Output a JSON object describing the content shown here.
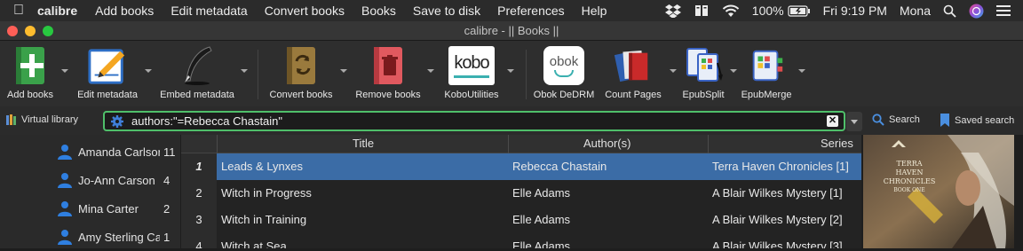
{
  "menubar": {
    "app_name": "calibre",
    "items": [
      "Add books",
      "Edit metadata",
      "Convert books",
      "Books",
      "Save to disk",
      "Preferences",
      "Help"
    ],
    "battery": "100%",
    "clock": "Fri 9:19 PM",
    "user": "Mona"
  },
  "window": {
    "title": "calibre - || Books ||"
  },
  "toolbar": {
    "tools": [
      {
        "label": "Add books"
      },
      {
        "label": "Edit metadata"
      },
      {
        "label": "Embed metadata"
      },
      {
        "label": "Convert books"
      },
      {
        "label": "Remove books"
      },
      {
        "label": "KoboUtilities"
      },
      {
        "label": "Obok DeDRM"
      },
      {
        "label": "Count Pages"
      },
      {
        "label": "EpubSplit"
      },
      {
        "label": "EpubMerge"
      }
    ],
    "kobo_text": "kobo",
    "obok_text": "obok"
  },
  "search": {
    "virtual_library": "Virtual library",
    "query": "authors:\"=Rebecca Chastain\"",
    "search_label": "Search",
    "saved_search_label": "Saved search"
  },
  "sidebar": {
    "authors": [
      {
        "name": "Amanda Carlson",
        "count": "11"
      },
      {
        "name": "Jo-Ann Carson",
        "count": "4"
      },
      {
        "name": "Mina Carter",
        "count": "2"
      },
      {
        "name": "Amy Sterling Casil",
        "count": "1"
      }
    ]
  },
  "table": {
    "columns": [
      "Title",
      "Author(s)",
      "Series"
    ],
    "rows": [
      {
        "num": "1",
        "title": "Leads & Lynxes",
        "author": "Rebecca Chastain",
        "series": "Terra Haven Chronicles [1]"
      },
      {
        "num": "2",
        "title": "Witch in Progress",
        "author": "Elle Adams",
        "series": "A Blair Wilkes Mystery [1]"
      },
      {
        "num": "3",
        "title": "Witch in Training",
        "author": "Elle Adams",
        "series": "A Blair Wilkes Mystery [2]"
      },
      {
        "num": "4",
        "title": "Witch at Sea",
        "author": "Elle Adams",
        "series": "A Blair Wilkes Mystery [3]"
      }
    ]
  },
  "cover": {
    "line1": "TERRA HAVEN",
    "line2": "CHRONICLES",
    "line3": "BOOK ONE"
  }
}
